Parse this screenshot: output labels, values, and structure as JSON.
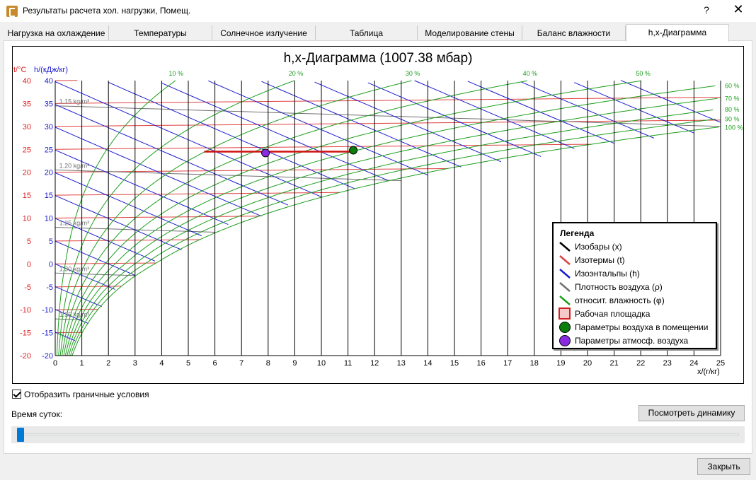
{
  "window": {
    "title": "Результаты расчета хол. нагрузки, Помещ.",
    "help": "?",
    "close": "✕"
  },
  "tabs": [
    {
      "label": "Нагрузка на охлаждение"
    },
    {
      "label": "Температуры"
    },
    {
      "label": "Солнечное излучение"
    },
    {
      "label": "Таблица"
    },
    {
      "label": "Моделирование стены"
    },
    {
      "label": "Баланс влажности"
    },
    {
      "label": "h,x-Диаграмма"
    }
  ],
  "active_tab": "h,x-Диаграмма",
  "chart_data": {
    "type": "line",
    "title": "h,x-Диаграмма (1007.38 мбар)",
    "xlabel": "x/(г/кг)",
    "ylabel_left": "t/°C",
    "ylabel_right": "h/(кДж/кг)",
    "xlim": [
      0,
      25
    ],
    "ylim": [
      -20,
      40
    ],
    "x_ticks": [
      "0",
      "1",
      "2",
      "3",
      "4",
      "5",
      "6",
      "7",
      "8",
      "9",
      "10",
      "11",
      "12",
      "13",
      "14",
      "15",
      "16",
      "17",
      "18",
      "19",
      "20",
      "21",
      "22",
      "23",
      "24",
      "25"
    ],
    "t_ticks": [
      "40",
      "35",
      "30",
      "25",
      "20",
      "15",
      "10",
      "5",
      "0",
      "-5",
      "-10",
      "-15",
      "-20"
    ],
    "h_ticks": [
      "40",
      "35",
      "30",
      "25",
      "20",
      "15",
      "10",
      "5",
      "0",
      "-5",
      "-10",
      "-15",
      "-20"
    ],
    "rh_labels_top": [
      "10 %",
      "20 %",
      "30 %",
      "40 %",
      "50 %"
    ],
    "rh_labels_right": [
      "60 %",
      "70 %",
      "80 %",
      "90 %",
      "100 %"
    ],
    "density_labels": [
      "1.15 kg/m³",
      "1.20 kg/m³",
      "1.25 kg/m³",
      "1.30 kg/m³",
      "1.35 kg/m³"
    ],
    "grid": true,
    "pressure_mbar": 1007.38,
    "points": {
      "room_air": {
        "name": "Параметры воздуха в помещении",
        "x": 11.2,
        "t": 24.8,
        "color": "#0b7d0b"
      },
      "outdoor_air": {
        "name": "Параметры атмосф. воздуха",
        "x": 7.9,
        "t": 24.2,
        "color": "#8a2be2"
      }
    },
    "working_area": {
      "x": [
        5.6,
        11.3
      ],
      "t": 24.5
    },
    "colors": {
      "isobars": "#000000",
      "isotherms": "#e04040",
      "isenthalps": "#1a1ad0",
      "density": "#707070",
      "humidity": "#1e9e1e",
      "t_axis": "#e02020",
      "h_axis": "#1a1ad0",
      "rh_label": "#1e9e1e"
    }
  },
  "legend": {
    "title": "Легенда",
    "items": [
      {
        "label": "Изобары (x)",
        "icon": "line-black"
      },
      {
        "label": "Изотермы (t)",
        "icon": "line-red"
      },
      {
        "label": "Изоэнтальпы (h)",
        "icon": "line-blue"
      },
      {
        "label": "Плотность воздуха (ρ)",
        "icon": "line-gray"
      },
      {
        "label": "относит. влажность (φ)",
        "icon": "line-green"
      },
      {
        "label": "Рабочая площадка",
        "icon": "square-red"
      },
      {
        "label": "Параметры воздуха в помещении",
        "icon": "circle-green"
      },
      {
        "label": "Параметры атмосф. воздуха",
        "icon": "circle-purple"
      }
    ]
  },
  "show_boundary": {
    "label": "Отобразить граничные условия",
    "checked": true
  },
  "time_of_day": {
    "label": "Время суток:",
    "value": 0
  },
  "buttons": {
    "dynamics": "Посмотреть динамику",
    "close": "Закрыть"
  }
}
